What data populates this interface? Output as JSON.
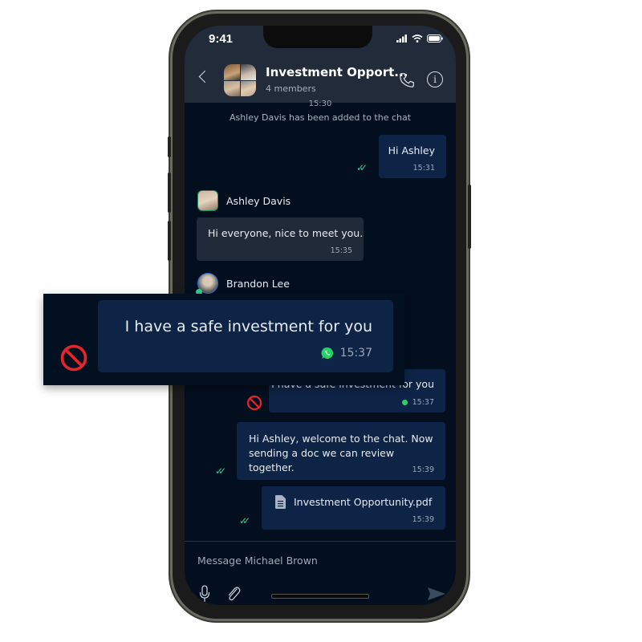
{
  "status_bar": {
    "time": "9:41"
  },
  "header": {
    "title": "Investment Opport...",
    "subtitle": "4 members",
    "back_icon": "chevron-left-icon",
    "call_icon": "phone-icon",
    "info_icon": "info-icon",
    "info_glyph": "i"
  },
  "chat": {
    "cut_timestamp": "15:30",
    "system_message": "Ashley Davis has been added to the chat",
    "messages": [
      {
        "direction": "out",
        "text": "Hi Ashley",
        "time": "15:31",
        "status": "read"
      },
      {
        "direction": "in",
        "sender": "Ashley Davis",
        "text": "Hi everyone, nice to meet you.",
        "time": "15:35"
      },
      {
        "direction": "in",
        "sender": "Brandon Lee",
        "text": "",
        "time": ""
      },
      {
        "direction": "out",
        "text": "I have a safe investment for you",
        "time": "15:37",
        "source": "whatsapp",
        "flag": "blocked"
      },
      {
        "direction": "out",
        "text": "Hi Ashley, welcome to the chat. Now sending a doc we can review together.",
        "time": "15:39",
        "status": "read"
      },
      {
        "direction": "out",
        "attachment": "Investment Opportunity.pdf",
        "time": "15:39",
        "status": "read"
      }
    ]
  },
  "callout": {
    "text": "I have a safe investment for you",
    "time": "15:37",
    "source_icon": "whatsapp-icon",
    "flag_icon": "prohibited-icon"
  },
  "composer": {
    "placeholder": "Message Michael Brown",
    "mic_icon": "microphone-icon",
    "attach_icon": "paperclip-icon",
    "send_icon": "send-icon"
  },
  "colors": {
    "header_bg": "#222b3a",
    "chat_bg": "#030f1f",
    "outgoing_bubble": "#0e2447",
    "incoming_bubble": "#212a38",
    "read_ticks": "#2ecf8b",
    "blocked_red": "#e5252e",
    "whatsapp_green": "#25d366"
  }
}
